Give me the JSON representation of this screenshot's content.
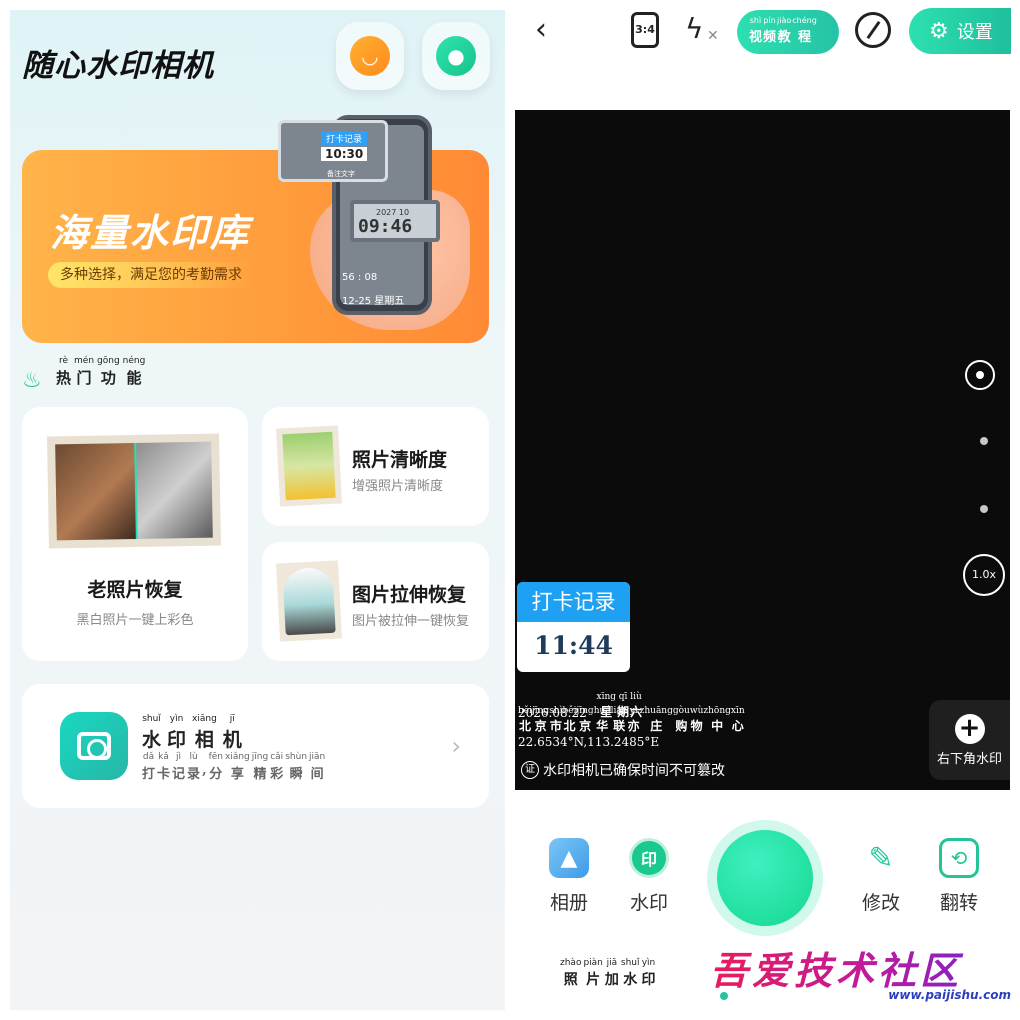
{
  "left": {
    "app_title": "随心水印相机",
    "message_icon": "message-bubble-icon",
    "profile_icon": "user-profile-icon",
    "banner": {
      "title": "海量水印库",
      "subtitle": "多种选择，满足您的考勤需求",
      "card_tag": "打卡记录",
      "card_time": "10:30",
      "card_note": "备注文字",
      "lcd_date": "2027 10",
      "lcd_time": "09:46",
      "slot_time": "56 : 08",
      "slot_date": "12-25  星期五"
    },
    "hot_section": {
      "pinyin": [
        "rè",
        "mén",
        "gōng",
        "néng"
      ],
      "chars": [
        "热",
        "门",
        "功",
        "能"
      ]
    },
    "tiles": {
      "old_photo": {
        "title": "老照片恢复",
        "subtitle": "黑白照片一键上彩色"
      },
      "sharpness": {
        "title": "照片清晰度",
        "subtitle": "增强照片清晰度"
      },
      "stretch": {
        "title": "图片拉伸恢复",
        "subtitle": "图片被拉伸一键恢复"
      }
    },
    "camera_tile": {
      "title_pinyin": [
        "shuǐ",
        "yìn",
        "xiāng",
        "jī"
      ],
      "title_chars": [
        "水",
        "印",
        "相",
        "机"
      ],
      "sub_pinyin": [
        "dǎ",
        "kǎ",
        "jì",
        "lù",
        "",
        "fēn",
        "xiǎng",
        "jīng",
        "cǎi",
        "shùn",
        "jiān"
      ],
      "sub_chars": [
        "打",
        "卡",
        "记",
        "录",
        ",",
        "分",
        "享",
        "精",
        "彩",
        "瞬",
        "间"
      ]
    }
  },
  "right": {
    "toolbar": {
      "ratio": "3:4",
      "tutorial_pinyin": [
        "shì",
        "pín",
        "jiào",
        "chéng"
      ],
      "tutorial_chars": [
        "视",
        "频",
        "教",
        "程"
      ],
      "settings_label": "设置"
    },
    "viewfinder": {
      "zoom": "1.0x",
      "watermark_tag": "打卡记录",
      "watermark_time": "11:44",
      "date_line": "2026.08.22",
      "weekday_pinyin": [
        "xīng",
        "qī",
        "liù"
      ],
      "weekday_chars": [
        "星",
        "期",
        "六"
      ],
      "address_pinyin": [
        "běi",
        "jīng",
        "shì",
        "běi",
        "jīng",
        "huá",
        "lián",
        "yì",
        "zhuāng",
        "gòu",
        "wù",
        "zhōng",
        "xīn"
      ],
      "address_chars": [
        "北",
        "京",
        "市",
        "北",
        "京",
        "华",
        "联",
        "亦",
        "庄",
        "购",
        "物",
        "中",
        "心"
      ],
      "coords": "22.6534°N,113.2485°E",
      "verify_seal": "证",
      "verify_note": "水印相机已确保时间不可篡改",
      "corner_watermark": "右下角水印"
    },
    "tools": {
      "album": "相册",
      "watermark": "水印",
      "edit": "修改",
      "flip": "翻转",
      "watermark_glyph": "印"
    },
    "modes": {
      "photo_watermark_pinyin": [
        "zhào",
        "piàn",
        "jiā",
        "shuǐ",
        "yìn"
      ],
      "photo_watermark_chars": [
        "照",
        "片",
        "加",
        "水",
        "印"
      ]
    },
    "site_logo": {
      "text": "吾爱技术社区",
      "url": "www.paijishu.com"
    }
  }
}
